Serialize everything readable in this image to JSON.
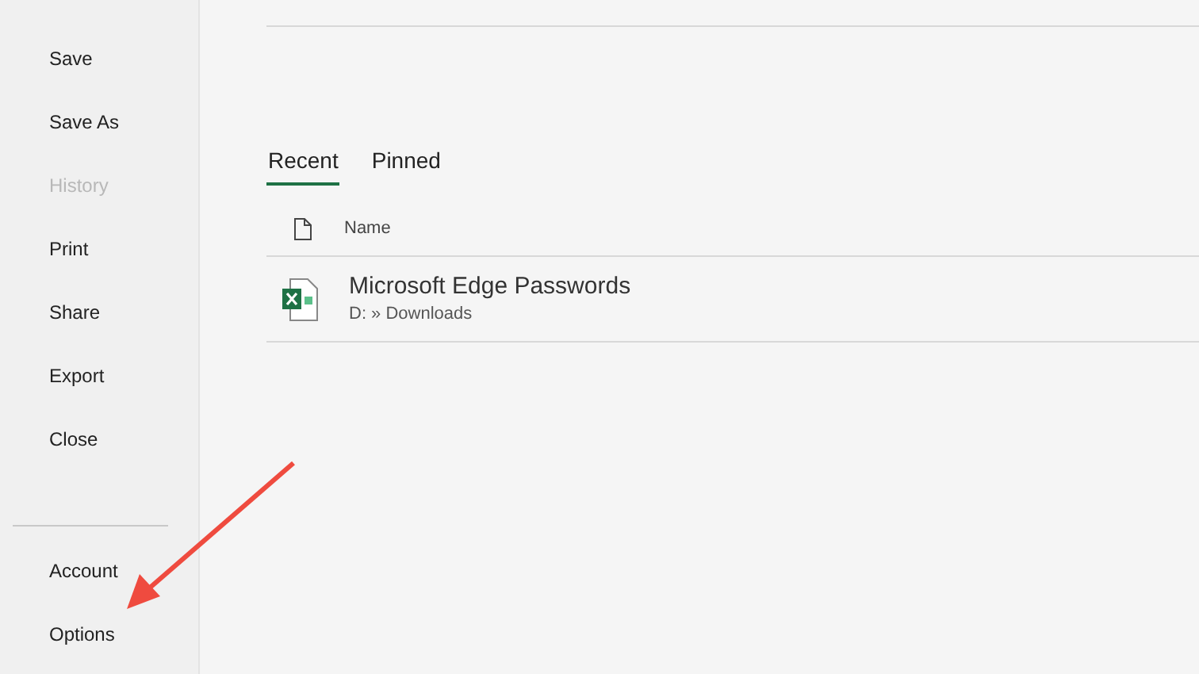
{
  "sidebar": {
    "items": [
      {
        "label": "Save",
        "disabled": false
      },
      {
        "label": "Save As",
        "disabled": false
      },
      {
        "label": "History",
        "disabled": true
      },
      {
        "label": "Print",
        "disabled": false
      },
      {
        "label": "Share",
        "disabled": false
      },
      {
        "label": "Export",
        "disabled": false
      },
      {
        "label": "Close",
        "disabled": false
      }
    ],
    "bottom_items": [
      {
        "label": "Account",
        "disabled": false
      },
      {
        "label": "Options",
        "disabled": false
      }
    ]
  },
  "tabs": [
    {
      "label": "Recent",
      "selected": true
    },
    {
      "label": "Pinned",
      "selected": false
    }
  ],
  "file_list": {
    "columns": [
      "Name"
    ],
    "rows": [
      {
        "name": "Microsoft Edge Passwords",
        "path": "D: » Downloads"
      }
    ]
  }
}
